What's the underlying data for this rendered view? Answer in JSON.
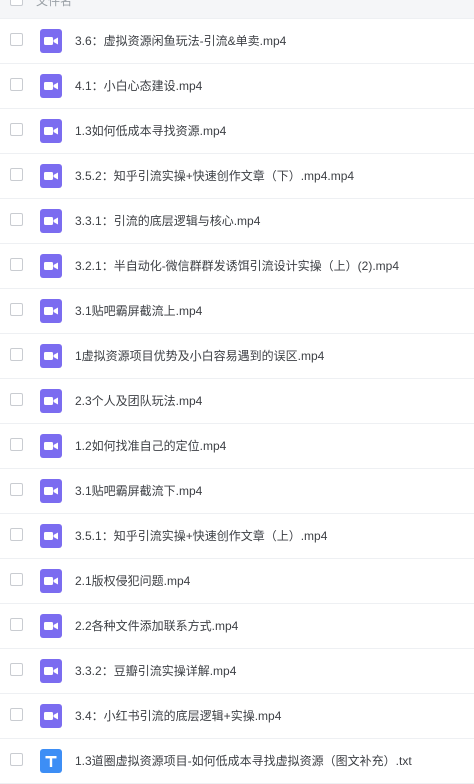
{
  "header": {
    "column_label": "文件名"
  },
  "files": [
    {
      "name": "3.6：虚拟资源闲鱼玩法-引流&单卖.mp4",
      "icon": "video-file-icon"
    },
    {
      "name": "4.1：小白心态建设.mp4",
      "icon": "video-file-icon"
    },
    {
      "name": "1.3如何低成本寻找资源.mp4",
      "icon": "video-file-icon"
    },
    {
      "name": "3.5.2：知乎引流实操+快速创作文章（下）.mp4.mp4",
      "icon": "video-file-icon"
    },
    {
      "name": "3.3.1：引流的底层逻辑与核心.mp4",
      "icon": "video-file-icon"
    },
    {
      "name": "3.2.1：半自动化-微信群群发诱饵引流设计实操（上）(2).mp4",
      "icon": "video-file-icon"
    },
    {
      "name": "3.1贴吧霸屏截流上.mp4",
      "icon": "video-file-icon"
    },
    {
      "name": "1虚拟资源项目优势及小白容易遇到的误区.mp4",
      "icon": "video-file-icon"
    },
    {
      "name": "2.3个人及团队玩法.mp4",
      "icon": "video-file-icon"
    },
    {
      "name": "1.2如何找准自己的定位.mp4",
      "icon": "video-file-icon"
    },
    {
      "name": "3.1贴吧霸屏截流下.mp4",
      "icon": "video-file-icon"
    },
    {
      "name": "3.5.1：知乎引流实操+快速创作文章（上）.mp4",
      "icon": "video-file-icon"
    },
    {
      "name": "2.1版权侵犯问题.mp4",
      "icon": "video-file-icon"
    },
    {
      "name": "2.2各种文件添加联系方式.mp4",
      "icon": "video-file-icon"
    },
    {
      "name": "3.3.2：豆瓣引流实操详解.mp4",
      "icon": "video-file-icon"
    },
    {
      "name": "3.4：小红书引流的底层逻辑+实操.mp4",
      "icon": "video-file-icon"
    },
    {
      "name": "1.3道圈虚拟资源项目-如何低成本寻找虚拟资源（图文补充）.txt",
      "icon": "text-file-icon"
    }
  ],
  "colors": {
    "video_icon": "#7b6cf0",
    "text_icon": "#3d8ef5"
  }
}
